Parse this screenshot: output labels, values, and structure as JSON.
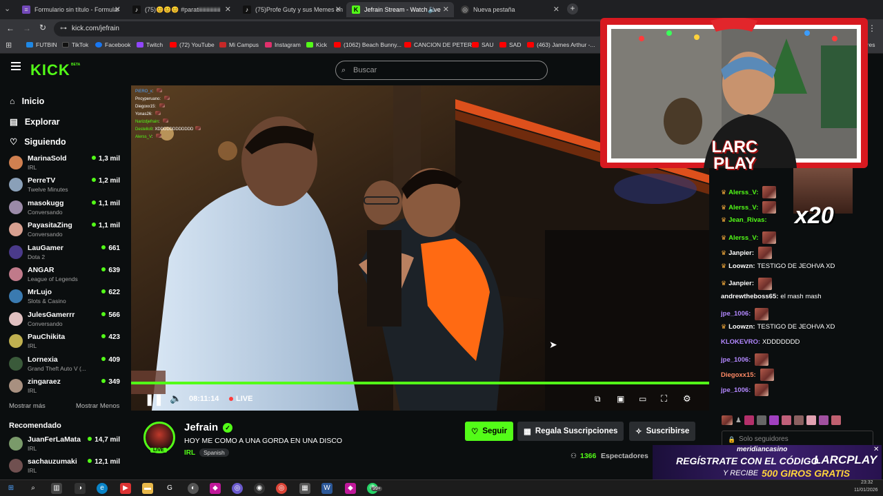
{
  "browser": {
    "tabs": [
      {
        "label": "Formulario sin título - Formular",
        "color": "#7248b9",
        "icon": "forms-icon"
      },
      {
        "label": "(75)😊😊😊 #paratiiiiiiiiiiiiiiii",
        "color": "#111",
        "icon": "tiktok-icon"
      },
      {
        "label": "(75)Profe Guty y sus Memes en",
        "color": "#111",
        "icon": "tiktok-icon"
      },
      {
        "label": "Jefrain Stream - Watch Live",
        "color": "#53fc18",
        "icon": "kick-icon"
      },
      {
        "label": "Nueva pestaña",
        "color": "#3c3c3c",
        "icon": "chrome-icon"
      }
    ],
    "url": "kick.com/jefrain",
    "bookmarks": [
      {
        "label": "FUTBIN",
        "color": "#1e88e5"
      },
      {
        "label": "TikTok",
        "color": "#111"
      },
      {
        "label": "Facebook",
        "color": "#1877f2"
      },
      {
        "label": "Twitch",
        "color": "#9146ff"
      },
      {
        "label": "(72) YouTube",
        "color": "#ff0000"
      },
      {
        "label": "Mi Campus",
        "color": "#c62828"
      },
      {
        "label": "Instagram",
        "color": "#e1306c"
      },
      {
        "label": "Kick",
        "color": "#53fc18"
      },
      {
        "label": "(1062) Beach Bunny...",
        "color": "#ff0000"
      },
      {
        "label": "CANCION DE PETER",
        "color": "#ff0000"
      },
      {
        "label": "SAU",
        "color": "#ff0000"
      },
      {
        "label": "SAD",
        "color": "#ff0000"
      },
      {
        "label": "(463) James Arthur -...",
        "color": "#ff0000"
      }
    ],
    "bookmarks_more": "ores"
  },
  "kick": {
    "logo": "KICK",
    "logo_badge": "BETA",
    "search_placeholder": "Buscar",
    "nav": [
      {
        "label": "Inicio",
        "icon": "home-icon"
      },
      {
        "label": "Explorar",
        "icon": "explore-icon"
      },
      {
        "label": "Siguiendo",
        "icon": "heart-icon"
      }
    ],
    "following": [
      {
        "name": "MarinaSold",
        "category": "IRL",
        "viewers": "1,3 mil",
        "color": "#d08050"
      },
      {
        "name": "PerreTV",
        "category": "Twelve Minutes",
        "viewers": "1,2 mil",
        "color": "#8aa0b8"
      },
      {
        "name": "masokugg",
        "category": "Conversando",
        "viewers": "1,1 mil",
        "color": "#9b8aa8"
      },
      {
        "name": "PayasitaZing",
        "category": "Conversando",
        "viewers": "1,1 mil",
        "color": "#d8a090"
      },
      {
        "name": "LauGamer",
        "category": "Dota 2",
        "viewers": "661",
        "color": "#4a3a8a"
      },
      {
        "name": "ANGAR",
        "category": "League of Legends",
        "viewers": "639",
        "color": "#c07a8a"
      },
      {
        "name": "MrLujo",
        "category": "Slots & Casino",
        "viewers": "622",
        "color": "#3a7ab0"
      },
      {
        "name": "JulesGamerrr",
        "category": "Conversando",
        "viewers": "566",
        "color": "#e0c0c0"
      },
      {
        "name": "PauChikita",
        "category": "IRL",
        "viewers": "423",
        "color": "#c0b050"
      },
      {
        "name": "Lornexia",
        "category": "Grand Theft Auto V (...",
        "viewers": "409",
        "color": "#3a5a3a"
      },
      {
        "name": "zingaraez",
        "category": "IRL",
        "viewers": "349",
        "color": "#a89080"
      }
    ],
    "show_more": "Mostrar más",
    "show_less": "Mostrar Menos",
    "recommended_title": "Recomendado",
    "recommended": [
      {
        "name": "JuanFerLaMata",
        "category": "IRL",
        "viewers": "14,7 mil",
        "color": "#7a9a6a"
      },
      {
        "name": "sachauzumaki",
        "category": "IRL",
        "viewers": "12,1 mil",
        "color": "#705050"
      }
    ]
  },
  "video": {
    "overlay_chat": [
      {
        "name": "PiERO_x",
        "text": ""
      },
      {
        "name": "Pncyperuano",
        "text": ""
      },
      {
        "name": "Diegoxx15",
        "text": ""
      },
      {
        "name": "Yonas26",
        "text": ""
      },
      {
        "name": "Narizdjefrain",
        "text": ""
      },
      {
        "name": "Destello9",
        "text": "XDDDDDDDDDDDD"
      },
      {
        "name": "Alerss_V",
        "text": ""
      }
    ],
    "time": "08:11:14",
    "live_label": "LIVE",
    "progress": 1.0
  },
  "stream": {
    "channel_name": "Jefrain",
    "title": "HOY ME COMO A UNA GORDA EN UNA DISCO",
    "category": "IRL",
    "tag": "Spanish",
    "avatar_live": "LIVE",
    "follow_label": "Seguir",
    "gift_label": "Regala Suscripciones",
    "subscribe_label": "Suscribirse",
    "viewers": "1366",
    "viewers_label": "Espectadores"
  },
  "chat": {
    "messages": [
      {
        "user": "Alerss_V:",
        "color": "#53fc18",
        "text": "",
        "crown": true,
        "emote": true
      },
      {
        "user": "Alerss_V:",
        "color": "#53fc18",
        "text": "",
        "crown": true,
        "emote": true
      },
      {
        "user": "Jean_Rivas:",
        "color": "#53fc18",
        "text": "",
        "crown": true,
        "emote": false
      },
      {
        "user": "Alerss_V:",
        "color": "#53fc18",
        "text": "",
        "crown": true,
        "emote": true
      },
      {
        "user": "Janpier:",
        "color": "#fff",
        "text": "",
        "crown": true,
        "emote": true
      },
      {
        "user": "Loowzn:",
        "color": "#fff",
        "text": "TESTIGO DE JEOHVA XD",
        "crown": true,
        "emote": false
      },
      {
        "user": "Janpier:",
        "color": "#fff",
        "text": "",
        "crown": true,
        "emote": true
      },
      {
        "user": "andrewtheboss65:",
        "color": "#fff",
        "text": "el mash mash",
        "crown": false,
        "emote": false
      },
      {
        "user": "jpe_1006:",
        "color": "#b388ff",
        "text": "",
        "crown": false,
        "emote": true
      },
      {
        "user": "Loowzn:",
        "color": "#fff",
        "text": "TESTIGO DE JEOHVA XD",
        "crown": true,
        "emote": false
      },
      {
        "user": "KLOKEVRO:",
        "color": "#b388ff",
        "text": "XDDDDDDD",
        "crown": false,
        "emote": false
      },
      {
        "user": "jpe_1006:",
        "color": "#b388ff",
        "text": "",
        "crown": false,
        "emote": true
      },
      {
        "user": "Diegoxx15:",
        "color": "#ff8a65",
        "text": "",
        "crown": false,
        "emote": true
      },
      {
        "user": "jpe_1006:",
        "color": "#b388ff",
        "text": "",
        "crown": false,
        "emote": true
      }
    ],
    "input_placeholder": "Solo seguidores",
    "x20": "x20"
  },
  "overlay": {
    "brand_line1": "LARC",
    "brand_line2": "PLAY"
  },
  "banner": {
    "sponsor": "meridiancasino",
    "line1": "REGÍSTRATE CON EL CÓDIGO",
    "code": "LARCPLAY",
    "line2": "Y RECIBE",
    "offer": "500 GIROS GRATIS"
  },
  "taskbar": {
    "badge": "99+",
    "time": "23:32",
    "date": "11/01/2026"
  }
}
